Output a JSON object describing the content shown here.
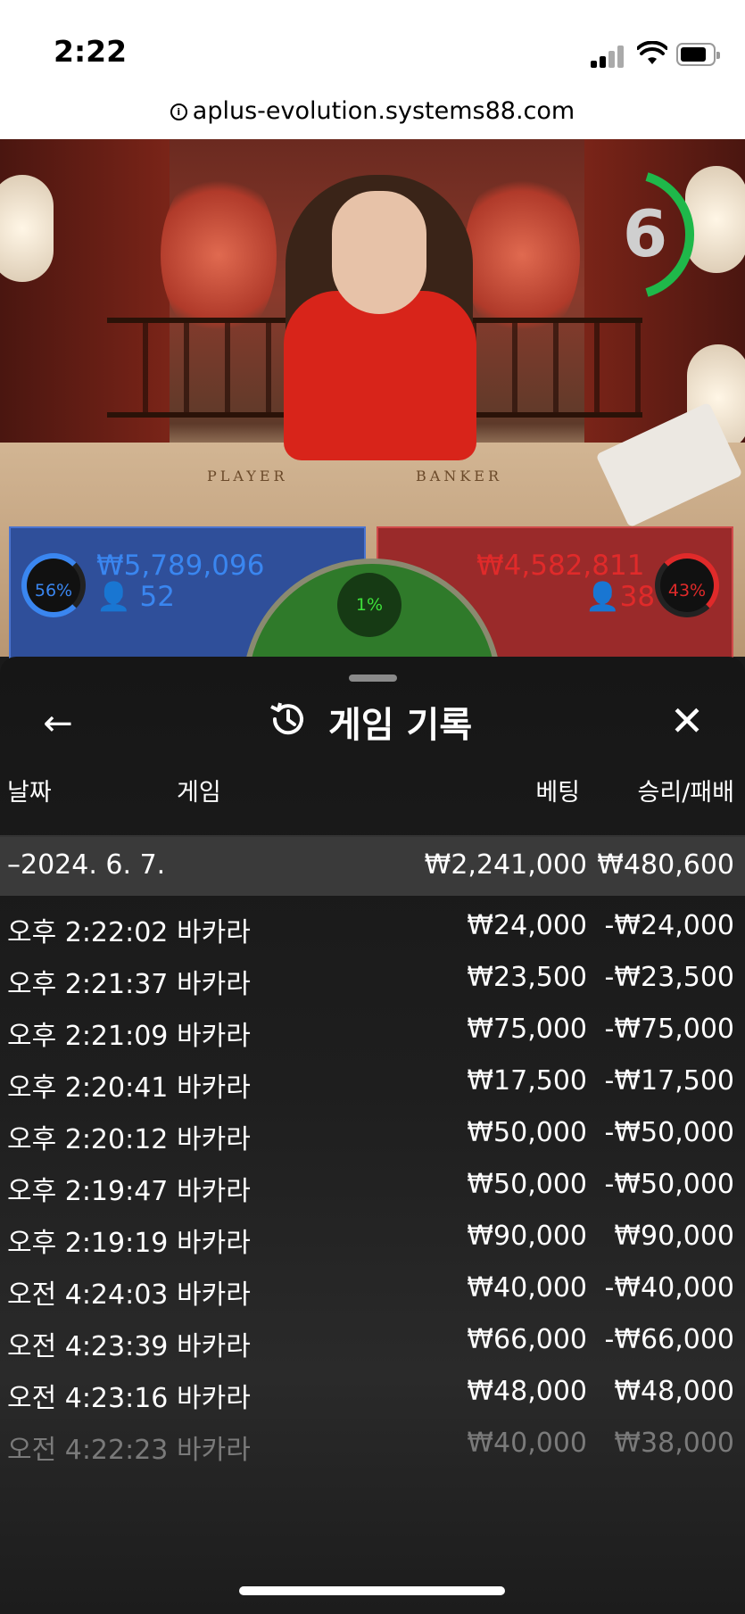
{
  "status_bar": {
    "time": "2:22"
  },
  "browser": {
    "url": "aplus-evolution.systems88.com"
  },
  "video": {
    "timer": "6",
    "table_labels": {
      "player": "PLAYER",
      "banker": "BANKER"
    }
  },
  "bets": {
    "player": {
      "percent": "56%",
      "amount": "₩5,789,096",
      "players": "52",
      "share": 0.56
    },
    "banker": {
      "percent": "43%",
      "amount": "₩4,582,811",
      "players": "38",
      "share": 0.43
    },
    "tie": {
      "percent": "1%"
    }
  },
  "panel": {
    "title": "게임 기록",
    "columns": {
      "date": "날짜",
      "game": "게임",
      "bet": "베팅",
      "result": "승리/패배"
    },
    "date_group": {
      "date": "–2024. 6. 7.",
      "bet_total": "₩2,241,000",
      "result_total": "₩480,600"
    },
    "rows": [
      {
        "time": "오후 2:22:02",
        "game": "바카라",
        "bet": "₩24,000",
        "result": "-₩24,000"
      },
      {
        "time": "오후 2:21:37",
        "game": "바카라",
        "bet": "₩23,500",
        "result": "-₩23,500"
      },
      {
        "time": "오후 2:21:09",
        "game": "바카라",
        "bet": "₩75,000",
        "result": "-₩75,000"
      },
      {
        "time": "오후 2:20:41",
        "game": "바카라",
        "bet": "₩17,500",
        "result": "-₩17,500"
      },
      {
        "time": "오후 2:20:12",
        "game": "바카라",
        "bet": "₩50,000",
        "result": "-₩50,000"
      },
      {
        "time": "오후 2:19:47",
        "game": "바카라",
        "bet": "₩50,000",
        "result": "-₩50,000"
      },
      {
        "time": "오후 2:19:19",
        "game": "바카라",
        "bet": "₩90,000",
        "result": "₩90,000"
      },
      {
        "time": "오전 4:24:03",
        "game": "바카라",
        "bet": "₩40,000",
        "result": "-₩40,000"
      },
      {
        "time": "오전 4:23:39",
        "game": "바카라",
        "bet": "₩66,000",
        "result": "-₩66,000"
      },
      {
        "time": "오전 4:23:16",
        "game": "바카라",
        "bet": "₩48,000",
        "result": "₩48,000"
      },
      {
        "time": "오전 4:22:23",
        "game": "바카라",
        "bet": "₩40,000",
        "result": "₩38,000"
      }
    ]
  },
  "colors": {
    "player": "#3a86f0",
    "banker": "#e02a2a",
    "tie": "#3ee03a",
    "timer_ring": "#1fb84a"
  }
}
